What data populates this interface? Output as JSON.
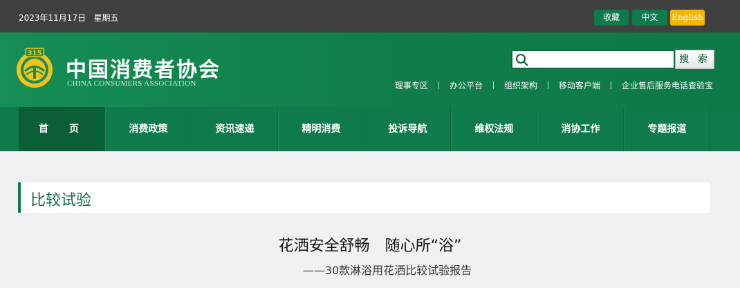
{
  "topbar": {
    "date": "2023年11月17日   星期五",
    "favorite_label": "收藏",
    "chinese_label": "中文",
    "english_label": "English"
  },
  "header": {
    "logo_cn": "中国消费者协会",
    "logo_en": "CHINA CONSUMERS ASSOCIATION",
    "emblem_text": "315",
    "search": {
      "placeholder": "",
      "button_label": "搜 索"
    },
    "quicklinks": [
      "理事专区",
      "办公平台",
      "组织架构",
      "移动客户端",
      "企业售后服务电话查验宝"
    ]
  },
  "nav": {
    "items": [
      "首　页",
      "消费政策",
      "资讯速递",
      "精明消费",
      "投诉导航",
      "维权法规",
      "消协工作",
      "专题报道"
    ],
    "active_index": 0
  },
  "section": {
    "title": "比较试验"
  },
  "article": {
    "title": "花洒安全舒畅　随心所“浴”",
    "subtitle": "——30款淋浴用花洒比较试验报告"
  },
  "colors": {
    "brand_green": "#0f7a4b",
    "topbar_gray": "#404040",
    "accent_yellow": "#f2b705"
  }
}
